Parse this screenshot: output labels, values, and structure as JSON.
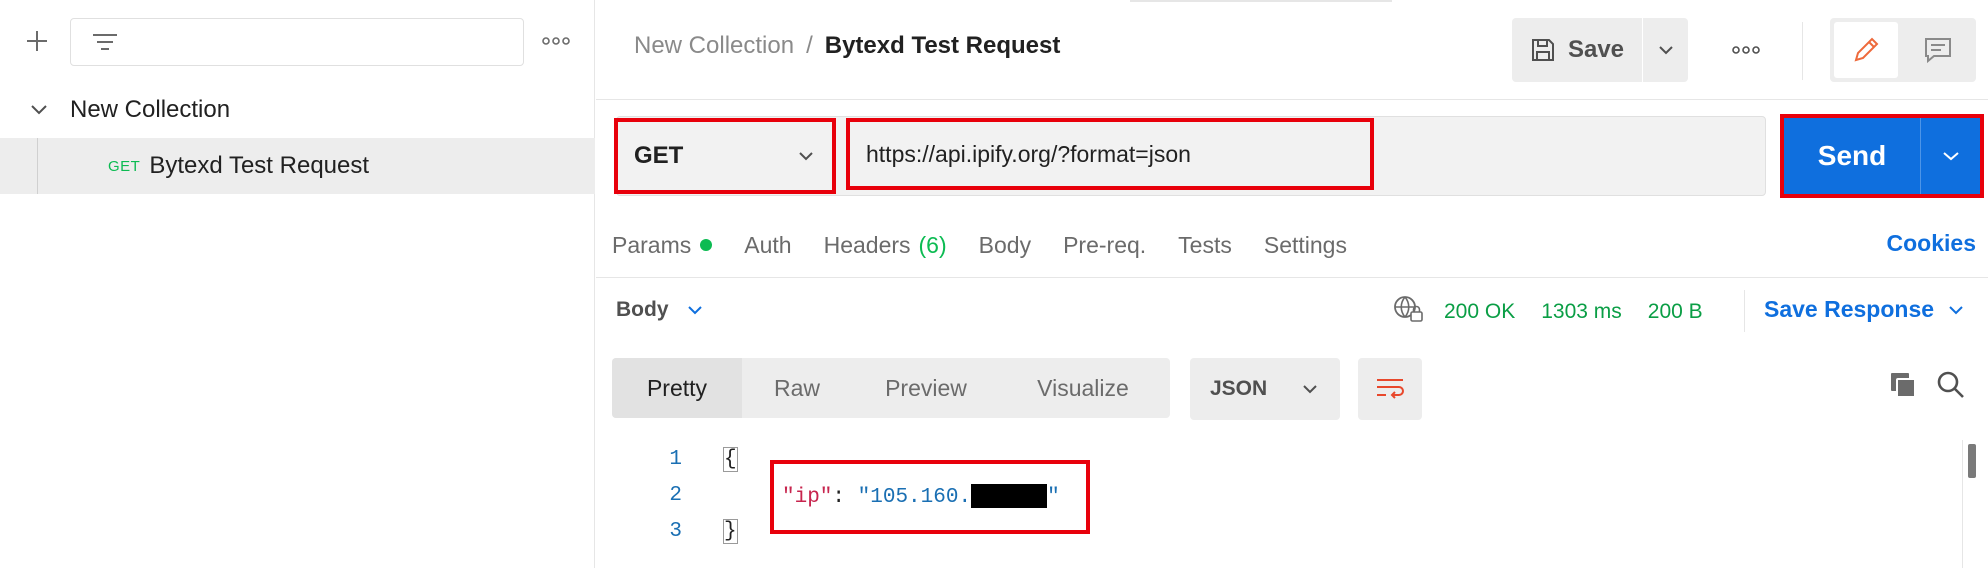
{
  "sidebar": {
    "collection": {
      "name": "New Collection"
    },
    "request": {
      "method": "GET",
      "name": "Bytexd Test Request"
    },
    "icons": {
      "add": "plus-icon",
      "filter": "filter-icon",
      "more": "more-horizontal-icon"
    }
  },
  "header": {
    "breadcrumb_parent": "New Collection",
    "breadcrumb_separator": "/",
    "breadcrumb_current": "Bytexd Test Request",
    "save_label": "Save"
  },
  "request": {
    "method": "GET",
    "url": "https://api.ipify.org/?format=json",
    "send_label": "Send",
    "tabs": [
      {
        "label": "Params"
      },
      {
        "label": "Auth"
      },
      {
        "label": "Headers",
        "count": "(6)"
      },
      {
        "label": "Body"
      },
      {
        "label": "Pre-req."
      },
      {
        "label": "Tests"
      },
      {
        "label": "Settings"
      }
    ],
    "cookies_label": "Cookies"
  },
  "response": {
    "body_label": "Body",
    "status": "200 OK",
    "time": "1303 ms",
    "size": "200 B",
    "save_response_label": "Save Response",
    "view_tabs": [
      "Pretty",
      "Raw",
      "Preview",
      "Visualize"
    ],
    "active_view": "Pretty",
    "format": "JSON",
    "code": {
      "line_numbers": [
        "1",
        "2",
        "3"
      ],
      "open_brace": "{",
      "close_brace": "}",
      "key": "\"ip\"",
      "colon": ": ",
      "value_prefix": "\"105.160.",
      "value_suffix": "\""
    }
  },
  "colors": {
    "accent_blue": "#0f6fde",
    "success_green": "#0cbb52",
    "highlight_red": "#e8000b",
    "json_key": "#c7254e",
    "json_value": "#1a6fb3"
  }
}
